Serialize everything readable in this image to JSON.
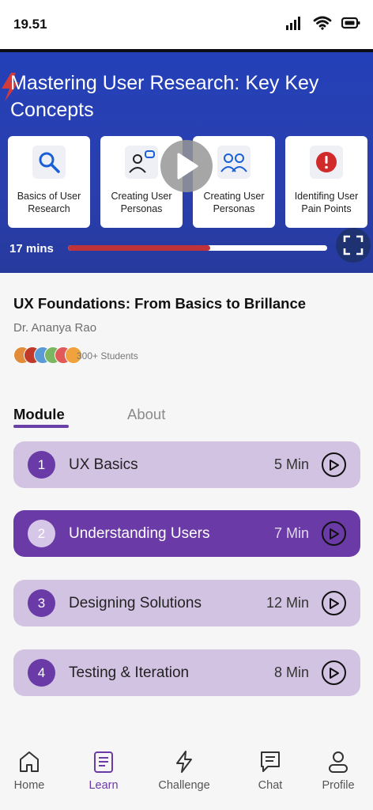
{
  "status_bar": {
    "time": "19.51",
    "icons": [
      "signal-icon",
      "wifi-icon",
      "battery-icon"
    ]
  },
  "video": {
    "title": "Mastering User Research: Key Key Concepts",
    "cards": [
      {
        "label": "Basics of User Research",
        "icon": "magnifier-icon"
      },
      {
        "label": "Creating User Personas",
        "icon": "persona-chat-icon"
      },
      {
        "label": "Creating User Personas",
        "icon": "two-users-icon"
      },
      {
        "label": "Identifing User Pain Points",
        "icon": "alert-icon"
      }
    ],
    "duration": "17 mins",
    "progress": 0.55,
    "colors": {
      "background": "#2440b8",
      "progress_fill": "#c0323a"
    }
  },
  "course": {
    "title": "UX Foundations: From Basics to Brillance",
    "instructor": "Dr. Ananya Rao",
    "students": "300+ Students"
  },
  "tabs": [
    {
      "label": "Module",
      "active": true
    },
    {
      "label": "About",
      "active": false
    }
  ],
  "modules": [
    {
      "number": "1",
      "label": "UX Basics",
      "duration": "5 Min",
      "active": false
    },
    {
      "number": "2",
      "label": "Understanding Users",
      "duration": "7 Min",
      "active": true
    },
    {
      "number": "3",
      "label": "Designing Solutions",
      "duration": "12 Min",
      "active": false
    },
    {
      "number": "4",
      "label": "Testing & Iteration",
      "duration": "8 Min",
      "active": false
    }
  ],
  "nav": [
    {
      "label": "Home",
      "icon": "home-icon",
      "active": false
    },
    {
      "label": "Learn",
      "icon": "learn-icon",
      "active": true
    },
    {
      "label": "Challenge",
      "icon": "lightning-icon",
      "active": false
    },
    {
      "label": "Chat",
      "icon": "chat-icon",
      "active": false
    },
    {
      "label": "Profile",
      "icon": "profile-icon",
      "active": false
    }
  ],
  "colors": {
    "accent": "#6a3aa6",
    "module_bg": "#d2c3e3"
  }
}
